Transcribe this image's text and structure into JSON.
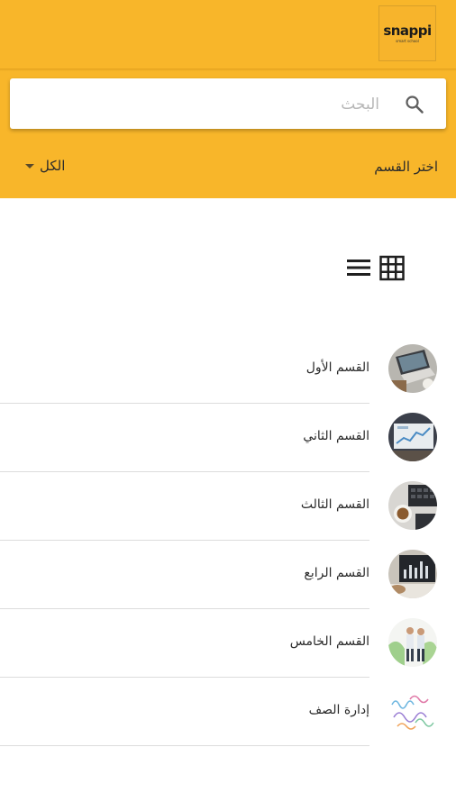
{
  "app": {
    "logo_text": "snappi",
    "logo_subtext": "smart school"
  },
  "search": {
    "placeholder": "البحث",
    "icon": "search-icon"
  },
  "filter": {
    "label": "اختر القسم",
    "selected": "الكل",
    "icon": "dropdown-triangle-icon"
  },
  "view_toggle": {
    "list_icon": "list-view-icon",
    "grid_icon": "grid-view-icon"
  },
  "sections": [
    {
      "label": "القسم الأول",
      "image": "laptop-desk-photo"
    },
    {
      "label": "القسم الثاني",
      "image": "analytics-screen-photo"
    },
    {
      "label": "القسم الثالث",
      "image": "keyboard-coffee-photo"
    },
    {
      "label": "القسم الرابع",
      "image": "tablet-chart-photo"
    },
    {
      "label": "القسم الخامس",
      "image": "business-people-photo"
    },
    {
      "label": "إدارة الصف",
      "image": "colorful-doodle-image"
    }
  ],
  "colors": {
    "header": "#f8b62a",
    "background": "#ffffff",
    "divider": "#dcdcdc"
  }
}
